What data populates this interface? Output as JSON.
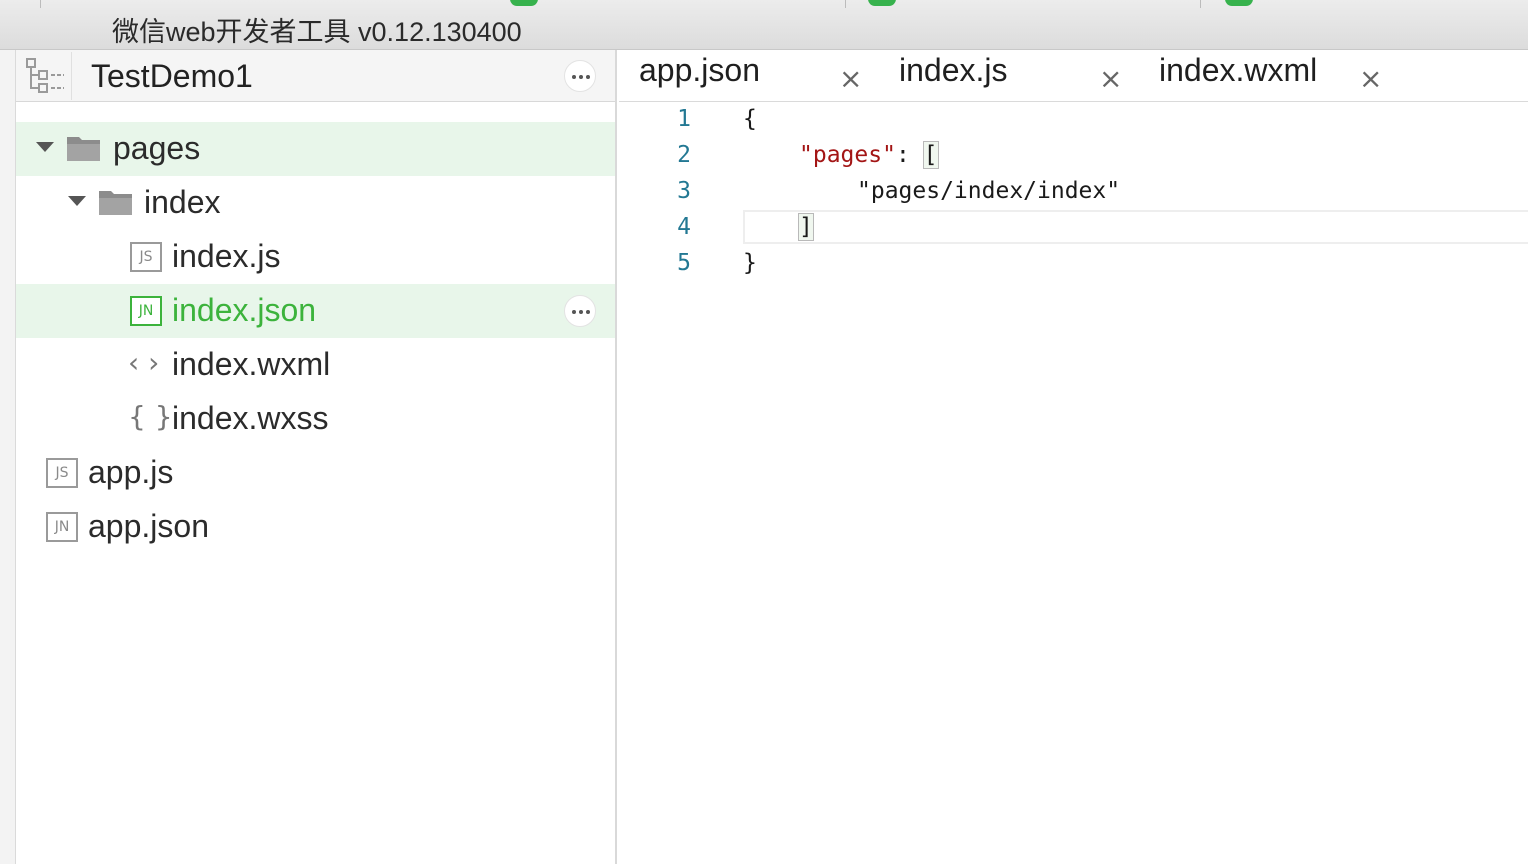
{
  "window": {
    "title": "微信web开发者工具 v0.12.130400"
  },
  "sidebar": {
    "project_name": "TestDemo1",
    "tree": [
      {
        "label": "pages",
        "type": "folder",
        "expanded": true
      },
      {
        "label": "index",
        "type": "folder",
        "expanded": true
      },
      {
        "label": "index.js",
        "type": "file",
        "icon_text": "JS"
      },
      {
        "label": "index.json",
        "type": "file",
        "icon_text": "JN",
        "selected": true
      },
      {
        "label": "index.wxml",
        "type": "file",
        "icon_glyph": "‹ ›"
      },
      {
        "label": "index.wxss",
        "type": "file",
        "icon_glyph": "{ }"
      },
      {
        "label": "app.js",
        "type": "file",
        "icon_text": "JS"
      },
      {
        "label": "app.json",
        "type": "file",
        "icon_text": "JN"
      }
    ]
  },
  "tabs": [
    {
      "label": "app.json",
      "close": "×"
    },
    {
      "label": "index.js",
      "close": "×"
    },
    {
      "label": "index.wxml",
      "close": "×"
    }
  ],
  "editor": {
    "line_numbers": [
      "1",
      "2",
      "3",
      "4",
      "5"
    ],
    "lines": {
      "l1": "{",
      "l2_key": "\"pages\"",
      "l2_colon": ": ",
      "l2_bracket": "[",
      "l3_value": "\"pages/index/index\"",
      "l4_bracket": "]",
      "l5": "}"
    }
  },
  "colors": {
    "accent_green": "#3cb33c",
    "selected_row_bg": "#e8f6ea",
    "string_red": "#a31515",
    "line_number_blue": "#237893"
  },
  "icons": [
    "tree-toggle-icon",
    "more-icon",
    "folder-icon",
    "js-file-icon",
    "json-file-icon",
    "wxml-file-icon",
    "wxss-file-icon",
    "close-icon",
    "expand-arrow-icon"
  ]
}
